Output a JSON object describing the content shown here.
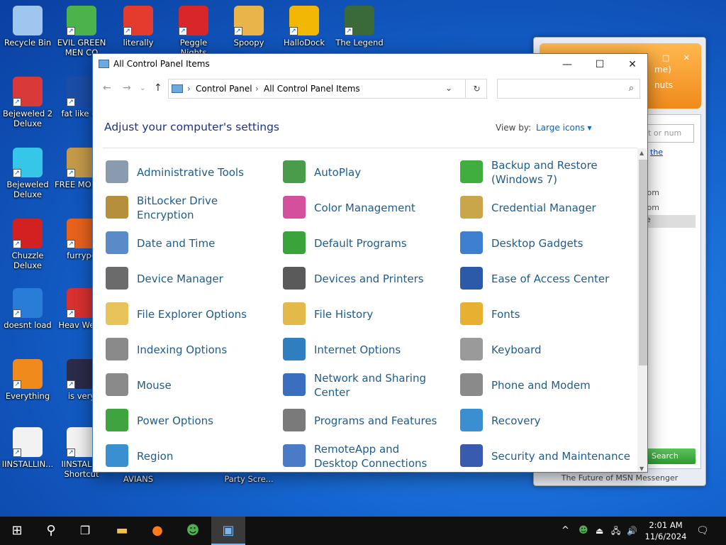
{
  "desktop": {
    "icons": [
      {
        "label": "Recycle Bin",
        "color": "#9fc6ef"
      },
      {
        "label": "Bejeweled 2 Deluxe",
        "color": "#d83a3a"
      },
      {
        "label": "Bejeweled Deluxe",
        "color": "#36c7e8"
      },
      {
        "label": "Chuzzle Deluxe",
        "color": "#d32020"
      },
      {
        "label": "doesnt load",
        "color": "#2a7dd6"
      },
      {
        "label": "Everything",
        "color": "#f08a1c"
      },
      {
        "label": "IINSTALLIN...",
        "color": "#f2f2f2"
      },
      {
        "label": "EVIL GREEN MEN CO",
        "color": "#4cb34c"
      },
      {
        "label": "fat like da",
        "color": "#1b4da6"
      },
      {
        "label": "FREE MONEY.",
        "color": "#c49a4a"
      },
      {
        "label": "furrypo",
        "color": "#e8621c"
      },
      {
        "label": "Heav Weap",
        "color": "#d93030"
      },
      {
        "label": "is very",
        "color": "#2b2b4a"
      },
      {
        "label": "IINSTALL - Shortcut",
        "color": "#f2f2f2"
      },
      {
        "label": "literally",
        "color": "#e33b2e"
      },
      {
        "label": "Peggle Nights",
        "color": "#d8262b"
      },
      {
        "label": "Spoopy",
        "color": "#e9b44a"
      },
      {
        "label": "HalloDock",
        "color": "#f2b705"
      },
      {
        "label": "The Legend",
        "color": "#3a6a3a"
      }
    ],
    "partial_labels": [
      "AVIANS",
      "Party Scre..."
    ]
  },
  "msn": {
    "top_line1": "me)",
    "top_line2": "nuts",
    "controls": "– □ ✕",
    "search_placeholder": "ct or num",
    "link": "the",
    "rows": [
      ".com",
      ".com"
    ],
    "selected": "e",
    "search_button": "Search",
    "footer": "The Future of MSN Messenger"
  },
  "window": {
    "title": "All Control Panel Items",
    "minimize": "—",
    "maximize": "☐",
    "close": "✕",
    "nav": {
      "back": "←",
      "forward": "→",
      "recent": "⌄",
      "up": "↑"
    },
    "breadcrumb": [
      "Control Panel",
      "All Control Panel Items"
    ],
    "crumb_sep": "›",
    "address_dropdown": "⌄",
    "refresh": "↻",
    "search_placeholder": "",
    "search_icon": "⌕",
    "heading": "Adjust your computer's settings",
    "view_by_label": "View by:",
    "view_by_value": "Large icons ▾",
    "items": [
      {
        "label": "Administrative Tools",
        "icon": "tools-icon",
        "color": "#8a9bb0"
      },
      {
        "label": "AutoPlay",
        "icon": "autoplay-icon",
        "color": "#4a9b4a"
      },
      {
        "label": "Backup and Restore (Windows 7)",
        "icon": "backup-icon",
        "color": "#3fae3f"
      },
      {
        "label": "BitLocker Drive Encryption",
        "icon": "bitlocker-icon",
        "color": "#b58f3c"
      },
      {
        "label": "Color Management",
        "icon": "color-management-icon",
        "color": "#d44f9c"
      },
      {
        "label": "Credential Manager",
        "icon": "credential-icon",
        "color": "#c9a64a"
      },
      {
        "label": "Date and Time",
        "icon": "clock-icon",
        "color": "#5a8bc8"
      },
      {
        "label": "Default Programs",
        "icon": "default-programs-icon",
        "color": "#3aa33a"
      },
      {
        "label": "Desktop Gadgets",
        "icon": "gadgets-icon",
        "color": "#3f7fcf"
      },
      {
        "label": "Device Manager",
        "icon": "device-manager-icon",
        "color": "#6b6b6b"
      },
      {
        "label": "Devices and Printers",
        "icon": "printer-icon",
        "color": "#5a5a5a"
      },
      {
        "label": "Ease of Access Center",
        "icon": "accessibility-icon",
        "color": "#2c5aa8"
      },
      {
        "label": "File Explorer Options",
        "icon": "folder-options-icon",
        "color": "#e8c35a"
      },
      {
        "label": "File History",
        "icon": "file-history-icon",
        "color": "#e3b94a"
      },
      {
        "label": "Fonts",
        "icon": "fonts-icon",
        "color": "#e8b030"
      },
      {
        "label": "Indexing Options",
        "icon": "indexing-icon",
        "color": "#8a8a8a"
      },
      {
        "label": "Internet Options",
        "icon": "globe-icon",
        "color": "#2f7fc0"
      },
      {
        "label": "Keyboard",
        "icon": "keyboard-icon",
        "color": "#9a9a9a"
      },
      {
        "label": "Mouse",
        "icon": "mouse-icon",
        "color": "#8a8a8a"
      },
      {
        "label": "Network and Sharing Center",
        "icon": "network-icon",
        "color": "#3a6fc0"
      },
      {
        "label": "Phone and Modem",
        "icon": "phone-icon",
        "color": "#8a8a8a"
      },
      {
        "label": "Power Options",
        "icon": "power-icon",
        "color": "#3fa33f"
      },
      {
        "label": "Programs and Features",
        "icon": "programs-icon",
        "color": "#7a7a7a"
      },
      {
        "label": "Recovery",
        "icon": "recovery-icon",
        "color": "#3a8fd0"
      },
      {
        "label": "Region",
        "icon": "region-icon",
        "color": "#3a8fd0"
      },
      {
        "label": "RemoteApp and Desktop Connections",
        "icon": "remoteapp-icon",
        "color": "#4a7ac8"
      },
      {
        "label": "Security and Maintenance",
        "icon": "flag-icon",
        "color": "#3a5ab0"
      }
    ]
  },
  "taskbar": {
    "start": "⊞",
    "search": "⚲",
    "taskview": "❐",
    "apps": [
      {
        "name": "file-explorer-icon",
        "glyph": "▬",
        "color": "#f2c24a"
      },
      {
        "name": "firefox-icon",
        "glyph": "●",
        "color": "#ff7a1a"
      },
      {
        "name": "msn-icon",
        "glyph": "☻",
        "color": "#4cb34c"
      },
      {
        "name": "control-panel-icon",
        "glyph": "▣",
        "color": "#7cb6f0"
      }
    ],
    "tray": {
      "chevron": "^",
      "volume": "🔊",
      "network": "🖧"
    },
    "time": "2:01 AM",
    "date": "11/6/2024",
    "notifications": "🗨"
  }
}
